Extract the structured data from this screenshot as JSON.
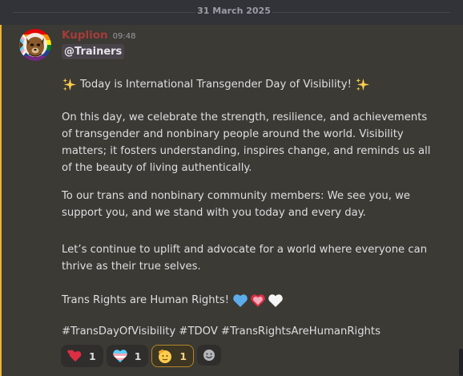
{
  "date_divider": "31 March 2025",
  "message": {
    "author": "Kuplion",
    "timestamp": "09:48",
    "mention": "@Trainers",
    "headline": "Today is International Transgender Day of Visibility!",
    "paragraph_2": "On this day, we celebrate the strength, resilience, and achievements of transgender and nonbinary people around the world. Visibility matters; it fosters understanding, inspires change, and reminds us all of the beauty of living authentically.",
    "paragraph_3": "To our trans and nonbinary community members: We see you, we support you, and we stand with you today and every day.",
    "paragraph_4": "Let’s continue to uplift and advocate for a world where everyone can thrive as their true selves.",
    "rights_line": "Trans Rights are Human Rights!",
    "hashtags": "#TransDayOfVisibility #TDOV #TransRightsAreHumanRights"
  },
  "reactions": [
    {
      "emoji": "heart-exclamation-icon",
      "count": "1",
      "active": false
    },
    {
      "emoji": "trans-heart-icon",
      "count": "1",
      "active": false
    },
    {
      "emoji": "saluting-face-icon",
      "count": "1",
      "active": true
    }
  ],
  "colors": {
    "background": "#323339",
    "highlight_background": "#3b3a34",
    "mention_bar": "#f0b232",
    "author_name": "#a63b3b",
    "trans_blue": "#5bcefa",
    "trans_pink": "#f5a9b8"
  }
}
